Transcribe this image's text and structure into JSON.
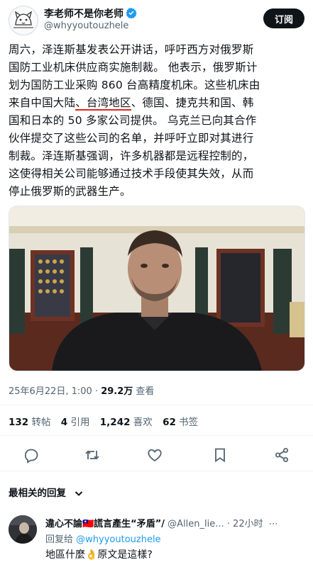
{
  "author": {
    "name": "李老师不是你老师",
    "handle": "@whyyoutouzhele",
    "follow_label": "订阅"
  },
  "tweet": {
    "lines": [
      "周六，泽连斯基发表公开讲话，呼吁西方对俄罗斯",
      "国防工业机床供应商实施制裁。  他表示，俄罗斯计",
      "划为国防工业采购 860 台高精度机床。这些机床由",
      "来自中国大陆",
      "、台湾地区",
      "、德国、捷克共和国、韩",
      "国和日本的 50 多家公司提供。 乌克兰已向其合作",
      "伙伴提交了这些公司的名单，并呼吁立即对其进行",
      "制裁。泽连斯基强调，许多机器都是远程控制的，",
      "这使得相关公司能够通过技术手段使其失效，从而",
      "停止俄罗斯的武器生产。"
    ]
  },
  "meta": {
    "timestamp": "25年6月22日, 1:00 · ",
    "views": "29.2万",
    "views_label": " 查看"
  },
  "stats": {
    "reposts": "132",
    "reposts_label": "转帖",
    "quotes": "4",
    "quotes_label": "引用",
    "likes": "1,242",
    "likes_label": "喜欢",
    "bookmarks": "62",
    "bookmarks_label": "书签"
  },
  "sort_label": "最相关的回复",
  "reply": {
    "name": "違心不論🇹🇼謊言產生“矛盾”/",
    "handle": "@Allen_lie...",
    "time": "· 22小时",
    "reply_to_prefix": "回复给 ",
    "reply_to_handle": "@whyyoutouzhele",
    "text": "地區什麼👌原文是這樣?"
  },
  "icons": [
    "verified-badge-icon",
    "reply-icon",
    "repost-icon",
    "like-icon",
    "bookmark-icon",
    "share-icon",
    "chevron-down-icon",
    "more-icon"
  ],
  "colors": {
    "accent": "#1d9bf0",
    "underline": "#e0261d",
    "text": "#0f1419",
    "muted": "#536471"
  }
}
